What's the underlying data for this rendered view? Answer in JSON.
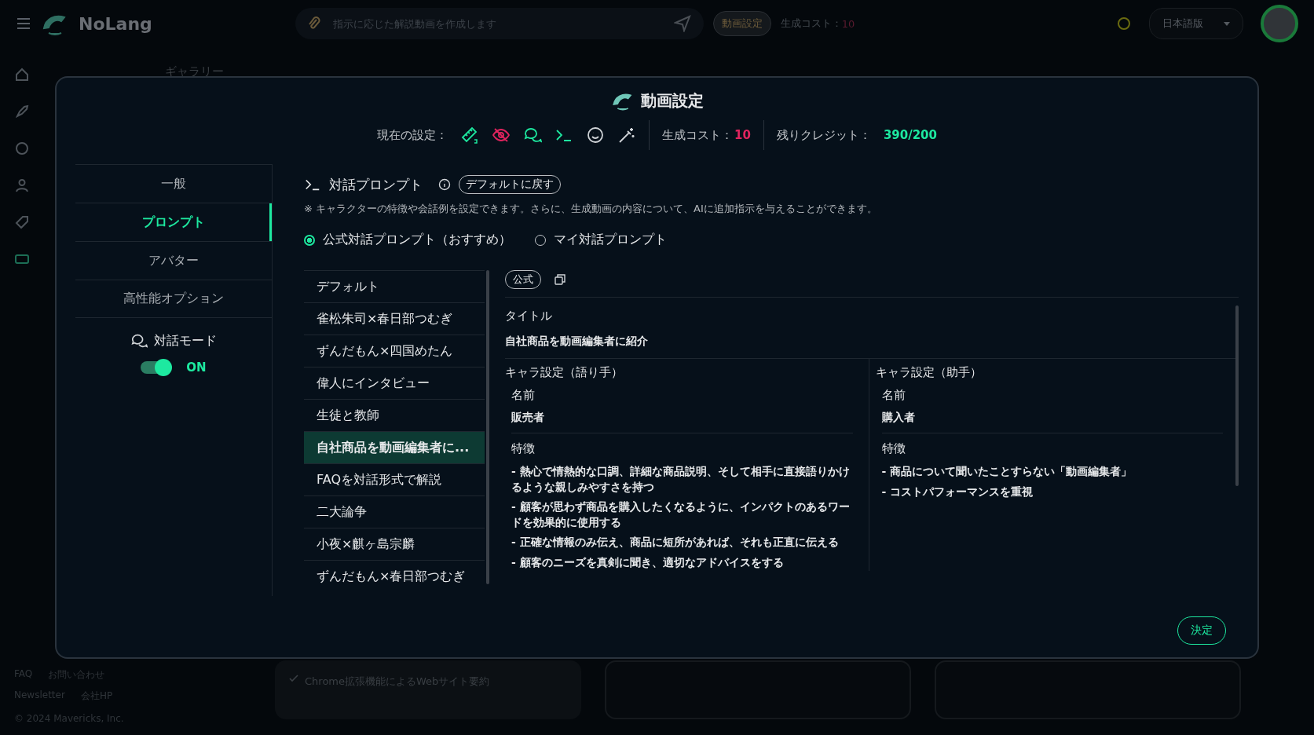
{
  "header": {
    "logo": "NoLang",
    "search_placeholder": "指示に応じた解説動画を作成します",
    "settings_button": "動画設定",
    "cost_label": "生成コスト：",
    "cost_value": "10",
    "language": "日本語版"
  },
  "background": {
    "gallery_label": "ギャラリー",
    "card_text": "Chrome拡張機能によるWebサイト要約"
  },
  "footer": {
    "links": [
      "FAQ",
      "お問い合わせ",
      "Newsletter",
      "会社HP"
    ],
    "copyright": "© 2024 Mavericks, Inc."
  },
  "modal": {
    "title": "動画設定",
    "current_label": "現在の設定：",
    "setting_icons": [
      {
        "kind": "ruler",
        "color": "#1de9a0"
      },
      {
        "kind": "eye-off",
        "color": "#e0245e"
      },
      {
        "kind": "chat",
        "color": "#1de9a0"
      },
      {
        "kind": "prompt",
        "color": "#1de9a0"
      },
      {
        "kind": "smile",
        "color": "#d0d4d8"
      },
      {
        "kind": "wand",
        "color": "#d0d4d8"
      }
    ],
    "cost_label": "生成コスト：",
    "cost_value": "10",
    "credits_label": "残りクレジット：",
    "credits_value": "390/200",
    "nav": [
      {
        "label": "一般",
        "selected": false
      },
      {
        "label": "プロンプト",
        "selected": true
      },
      {
        "label": "アバター",
        "selected": false
      },
      {
        "label": "高性能オプション",
        "selected": false
      }
    ],
    "dialog_mode": {
      "label": "対話モード",
      "on": true,
      "state_label": "ON"
    },
    "section_title": "対話プロンプト",
    "reset_button": "デフォルトに戻す",
    "note": "※ キャラクターの特徴や会話例を設定できます。さらに、生成動画の内容について、AIに追加指示を与えることができます。",
    "radios": [
      {
        "label": "公式対話プロンプト（おすすめ）",
        "selected": true
      },
      {
        "label": "マイ対話プロンプト",
        "selected": false
      }
    ],
    "prompts": [
      {
        "label": "デフォルト",
        "selected": false
      },
      {
        "label": "雀松朱司×春日部つむぎ",
        "selected": false
      },
      {
        "label": "ずんだもん×四国めたん",
        "selected": false
      },
      {
        "label": "偉人にインタビュー",
        "selected": false
      },
      {
        "label": "生徒と教師",
        "selected": false
      },
      {
        "label": "自社商品を動画編集者に...",
        "selected": true
      },
      {
        "label": "FAQを対話形式で解説",
        "selected": false
      },
      {
        "label": "二大論争",
        "selected": false
      },
      {
        "label": "小夜×麒ヶ島宗麟",
        "selected": false
      },
      {
        "label": "ずんだもん×春日部つむぎ",
        "selected": false
      }
    ],
    "detail": {
      "badge": "公式",
      "title_label": "タイトル",
      "title_value": "自社商品を動画編集者に紹介",
      "characters": [
        {
          "heading": "キャラ設定（語り手）",
          "name_label": "名前",
          "name": "販売者",
          "traits_label": "特徴",
          "traits": [
            "- 熱心で情熱的な口調、詳細な商品説明、そして相手に直接語りかけるような親しみやすさを持つ",
            "- 顧客が思わず商品を購入したくなるように、インパクトのあるワードを効果的に使用する",
            "- 正確な情報のみ伝え、商品に短所があれば、それも正直に伝える",
            "- 顧客のニーズを真剣に聞き、適切なアドバイスをする"
          ]
        },
        {
          "heading": "キャラ設定（助手）",
          "name_label": "名前",
          "name": "購入者",
          "traits_label": "特徴",
          "traits": [
            "- 商品について聞いたことすらない「動画編集者」",
            "- コストパフォーマンスを重視"
          ]
        }
      ]
    },
    "confirm_button": "決定"
  }
}
